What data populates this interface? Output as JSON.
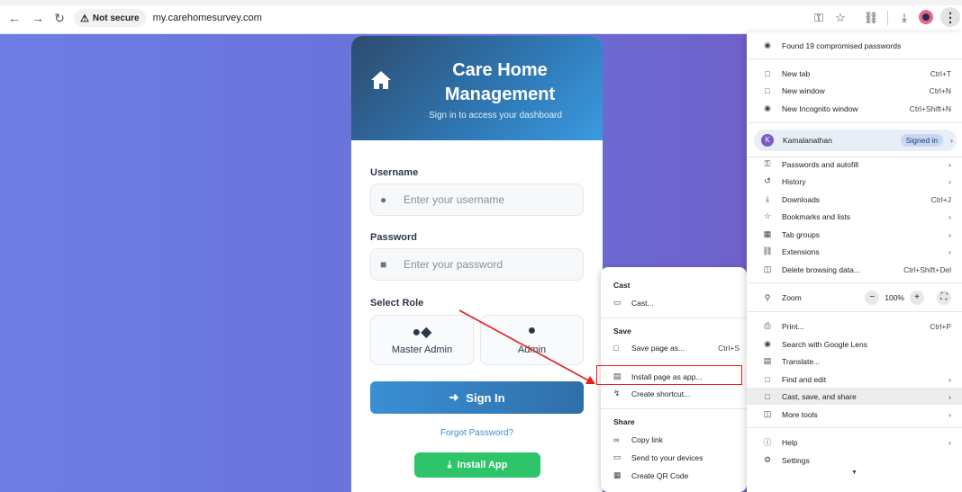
{
  "browser": {
    "not_secure": "Not secure",
    "url": "my.carehomesurvey.com"
  },
  "login": {
    "title": "Care Home Management",
    "subtitle": "Sign in to access your dashboard",
    "username_label": "Username",
    "username_placeholder": "Enter your username",
    "password_label": "Password",
    "password_placeholder": "Enter your password",
    "role_label": "Select Role",
    "roles": [
      {
        "label": "Master Admin"
      },
      {
        "label": "Admin"
      }
    ],
    "signin": "Sign In",
    "forgot": "Forgot Password?",
    "install": "Install App"
  },
  "submenu": {
    "cast_header": "Cast",
    "cast_item": "Cast...",
    "save_header": "Save",
    "save_page": "Save page as...",
    "save_shortcut": "Ctrl+S",
    "install_app": "Install page as app...",
    "create_shortcut": "Create shortcut...",
    "share_header": "Share",
    "copy_link": "Copy link",
    "send_devices": "Send to your devices",
    "qr_code": "Create QR Code"
  },
  "menu": {
    "compromised": "Found 19 compromised passwords",
    "new_tab": "New tab",
    "new_tab_key": "Ctrl+T",
    "new_window": "New window",
    "new_window_key": "Ctrl+N",
    "incognito": "New Incognito window",
    "incognito_key": "Ctrl+Shift+N",
    "profile_initial": "K",
    "profile_name": "Kamalanathan",
    "signed_in": "Signed in",
    "passwords": "Passwords and autofill",
    "history": "History",
    "downloads": "Downloads",
    "downloads_key": "Ctrl+J",
    "bookmarks": "Bookmarks and lists",
    "tab_groups": "Tab groups",
    "extensions": "Extensions",
    "delete_data": "Delete browsing data...",
    "delete_key": "Ctrl+Shift+Del",
    "zoom": "Zoom",
    "zoom_value": "100%",
    "print": "Print...",
    "print_key": "Ctrl+P",
    "lens": "Search with Google Lens",
    "translate": "Translate...",
    "find_edit": "Find and edit",
    "cast_save_share": "Cast, save, and share",
    "more_tools": "More tools",
    "help": "Help",
    "settings": "Settings"
  }
}
